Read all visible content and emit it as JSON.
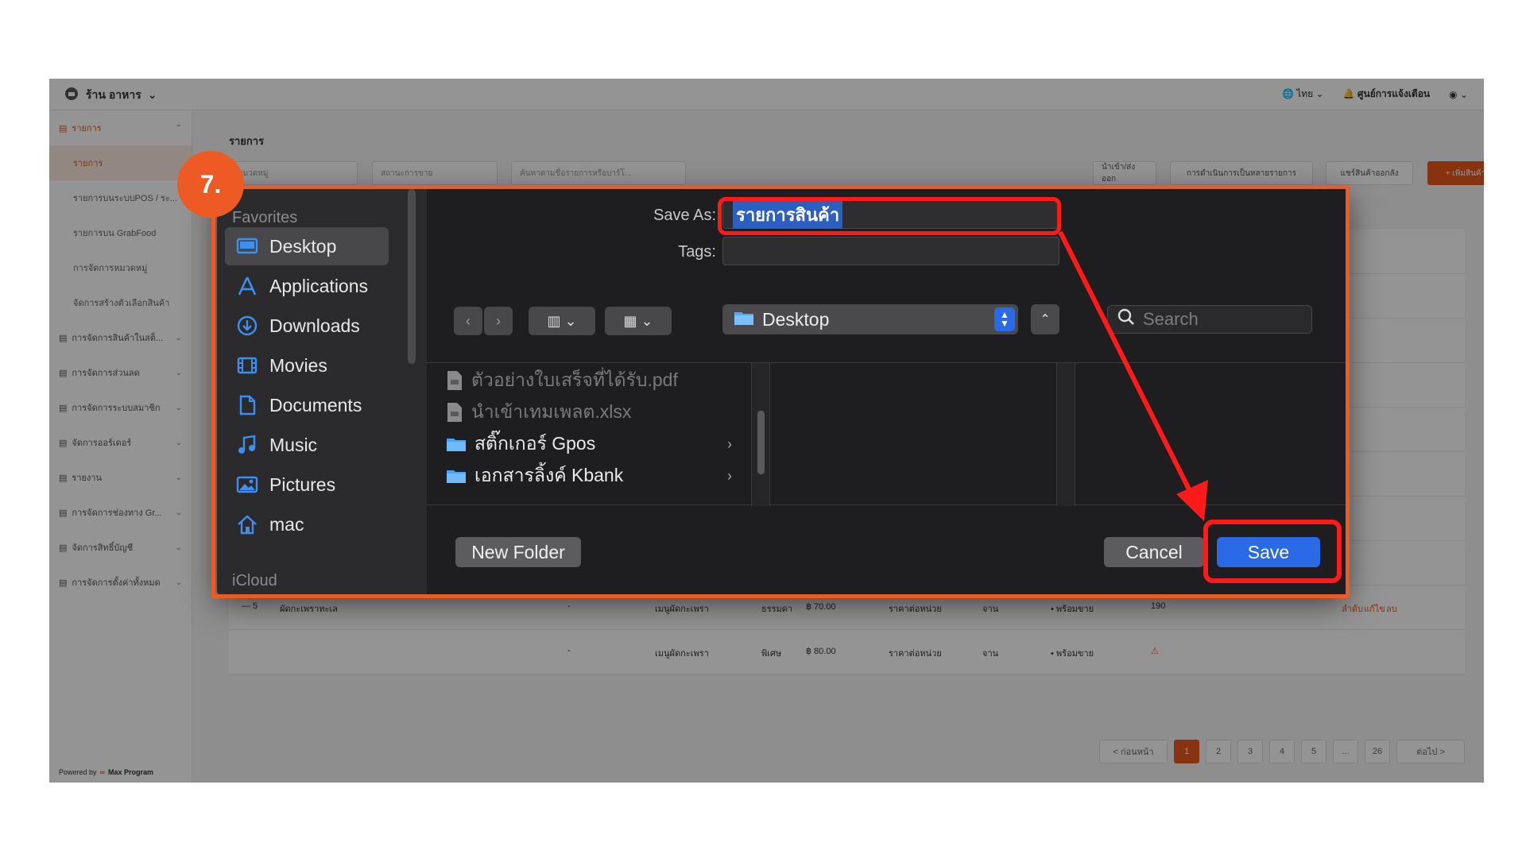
{
  "step_badge": "7.",
  "app": {
    "store_name": "ร้าน อาหาร",
    "language": "ไทย",
    "notifications": "ศูนย์การแจ้งเตือน",
    "page_title": "รายการ",
    "powered_by": "Powered by",
    "powered_brand": "Max Program",
    "sidebar": {
      "items": [
        {
          "label": "รายการ",
          "active": true
        },
        {
          "label": "รายการ",
          "sub": true,
          "selected": true
        },
        {
          "label": "รายการบนระบบPOS / ระ...",
          "sub": true
        },
        {
          "label": "รายการบน GrabFood",
          "sub": true
        },
        {
          "label": "การจัดการหมวดหมู่",
          "sub": true
        },
        {
          "label": "จัดการสร้างตัวเลือกสินค้า",
          "sub": true
        },
        {
          "label": "การจัดการสินค้าในสต็...",
          "expandable": true
        },
        {
          "label": "การจัดการส่วนลด",
          "expandable": true
        },
        {
          "label": "การจัดการระบบสมาชิก",
          "expandable": true
        },
        {
          "label": "จัดการออร์เดอร์",
          "expandable": true
        },
        {
          "label": "รายงาน",
          "expandable": true
        },
        {
          "label": "การจัดการช่องทาง Gr...",
          "expandable": true
        },
        {
          "label": "จัดการสิทธิ์บัญชี",
          "expandable": true
        },
        {
          "label": "การจัดการตั้งค่าทั้งหมด",
          "expandable": true
        }
      ]
    },
    "toolbar": {
      "category_placeholder": "หมวดหมู่",
      "status_placeholder": "สถานะการขาย",
      "search_placeholder": "ค้นหาตามชื่อรายการหรือบาร์โ...",
      "import_export": "นำเข้า/ส่งออก",
      "bulk_action": "การดำเนินการเป็นหลายรายการ",
      "share": "แชร์สินค้าออกลัง",
      "add_product": "+ เพิ่มสินค้า"
    },
    "rows": [
      {
        "idx": "— 5",
        "name": "ผัดกะเพราทะเล",
        "dash": "-",
        "category": "เมนูผัดกะเพรา",
        "option": "ธรรมดา",
        "price": "฿ 70.00",
        "unit_type": "ราคาต่อหน่วย",
        "unit": "จาน",
        "status": "• พร้อมขาย",
        "stock": "190"
      },
      {
        "idx": "",
        "name": "",
        "dash": "-",
        "category": "เมนูผัดกะเพรา",
        "option": "พิเศษ",
        "price": "฿ 80.00",
        "unit_type": "ราคาต่อหน่วย",
        "unit": "จาน",
        "status": "• พร้อมขาย",
        "stock": "⚠"
      }
    ],
    "row_actions": [
      "ลำดับ",
      "แก้ไข",
      "ลบ"
    ],
    "pager": {
      "prev": "< ก่อนหน้า",
      "pages": [
        "1",
        "2",
        "3",
        "4",
        "5",
        "...",
        "26"
      ],
      "next": "ต่อไป >"
    }
  },
  "dialog": {
    "favorites_header": "Favorites",
    "icloud_header": "iCloud",
    "favorites": [
      {
        "label": "Desktop",
        "icon": "desktop-icon",
        "selected": true
      },
      {
        "label": "Applications",
        "icon": "applications-icon"
      },
      {
        "label": "Downloads",
        "icon": "downloads-icon"
      },
      {
        "label": "Movies",
        "icon": "movies-icon"
      },
      {
        "label": "Documents",
        "icon": "documents-icon"
      },
      {
        "label": "Music",
        "icon": "music-icon"
      },
      {
        "label": "Pictures",
        "icon": "pictures-icon"
      },
      {
        "label": "mac",
        "icon": "home-icon"
      }
    ],
    "save_as_label": "Save As:",
    "save_as_value": "รายการสินค้า",
    "tags_label": "Tags:",
    "tags_value": "",
    "location": "Desktop",
    "search_placeholder": "Search",
    "files": [
      {
        "name": "ตัวอย่างใบเสร็จที่ได้รับ.pdf",
        "type": "file",
        "dimmed": true
      },
      {
        "name": "นำเข้าเทมเพลต.xlsx",
        "type": "file",
        "dimmed": true
      },
      {
        "name": "สติ๊กเกอร์ Gpos",
        "type": "folder"
      },
      {
        "name": "เอกสารลิ้งค์ Kbank",
        "type": "folder"
      }
    ],
    "new_folder": "New Folder",
    "cancel": "Cancel",
    "save": "Save"
  },
  "colors": {
    "accent": "#ee5a24",
    "highlight": "#ff1a1a",
    "mac_blue": "#2a6ae6"
  }
}
